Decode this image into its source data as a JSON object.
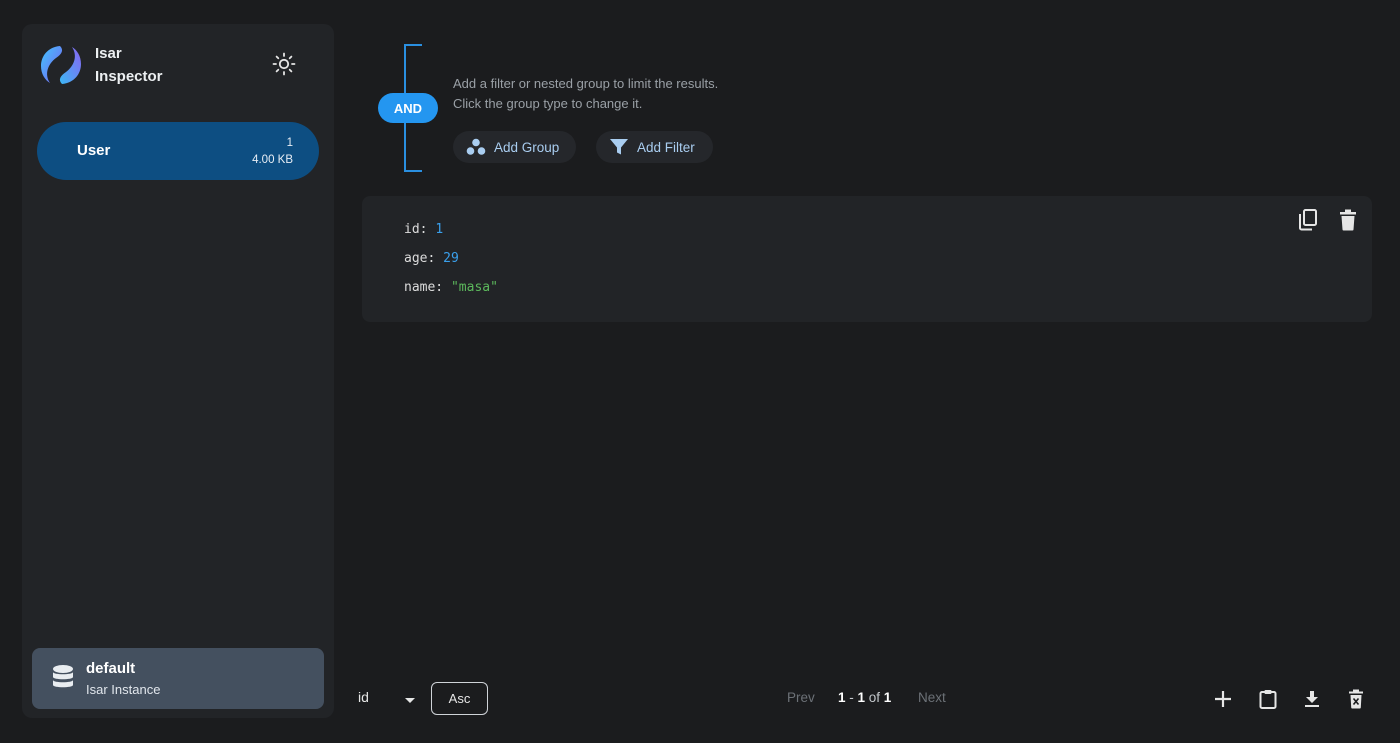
{
  "app": {
    "brand_line1": "Isar",
    "brand_line2": "Inspector"
  },
  "sidebar": {
    "collection": {
      "name": "User",
      "count": "1",
      "size": "4.00 KB"
    },
    "instance": {
      "name": "default",
      "subtitle": "Isar Instance"
    }
  },
  "filter": {
    "group_type": "AND",
    "hint_line1": "Add a filter or nested group to limit the results.",
    "hint_line2": "Click the group type to change it.",
    "add_group_label": "Add Group",
    "add_filter_label": "Add Filter"
  },
  "object": {
    "props": [
      {
        "key": "id:",
        "value": "1",
        "type": "num"
      },
      {
        "key": "age:",
        "value": "29",
        "type": "num"
      },
      {
        "key": "name:",
        "value": "\"masa\"",
        "type": "str"
      }
    ]
  },
  "footer": {
    "sort_field": "id",
    "sort_order": "Asc",
    "prev_label": "Prev",
    "next_label": "Next",
    "range_start": "1",
    "range_sep": " - ",
    "range_end": "1",
    "range_of": " of ",
    "total": "1"
  },
  "colors": {
    "accent": "#2496f0",
    "collection_selected": "#0d4e82",
    "number": "#3aa0ec",
    "string": "#5cb85c"
  },
  "icons": {
    "theme": "sun-icon",
    "copy": "copy-icon",
    "delete": "trash-icon",
    "add": "plus-icon",
    "paste": "clipboard-icon",
    "download": "download-icon",
    "clear": "trash-x-icon"
  }
}
